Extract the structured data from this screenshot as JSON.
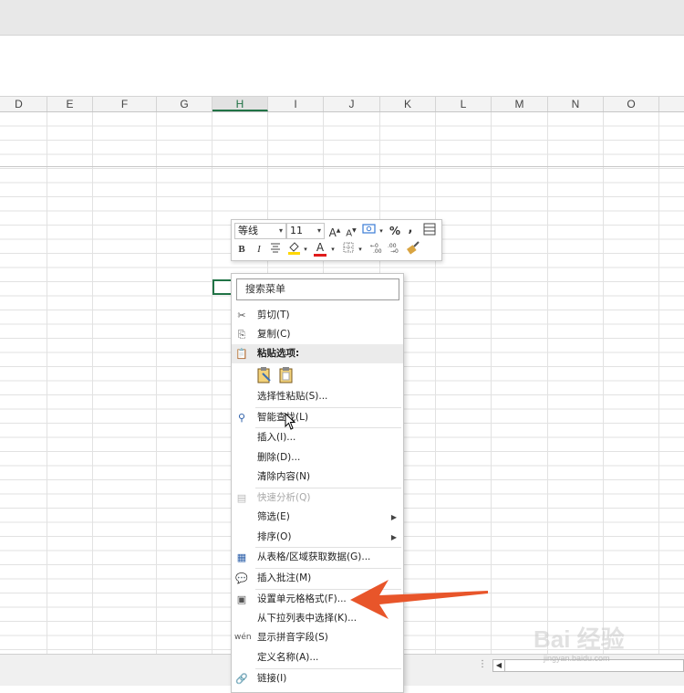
{
  "columns": [
    "D",
    "E",
    "F",
    "G",
    "H",
    "I",
    "J",
    "K",
    "L",
    "M",
    "N",
    "O"
  ],
  "selected_column": "H",
  "mini_toolbar": {
    "font_name": "等线",
    "font_size": "11",
    "grow_font": "A",
    "shrink_font": "A",
    "percent": "%",
    "comma": ",",
    "bold": "B",
    "italic": "I",
    "font_color_letter": "A"
  },
  "context_menu": {
    "search_placeholder": "搜索菜单",
    "items": {
      "cut": "剪切(T)",
      "copy": "复制(C)",
      "paste_options": "粘贴选项:",
      "paste_special": "选择性粘贴(S)...",
      "smart_lookup": "智能查找(L)",
      "insert": "插入(I)...",
      "delete": "删除(D)...",
      "clear_contents": "清除内容(N)",
      "quick_analysis": "快速分析(Q)",
      "filter": "筛选(E)",
      "sort": "排序(O)",
      "get_data_from_table": "从表格/区域获取数据(G)...",
      "insert_comment": "插入批注(M)",
      "format_cells": "设置单元格格式(F)...",
      "pick_from_list": "从下拉列表中选择(K)...",
      "show_phonetic": "显示拼音字段(S)",
      "define_name": "定义名称(A)...",
      "link": "链接(I)"
    }
  },
  "watermark": {
    "brand": "Bai 经验",
    "url": "jingyan.baidu.com"
  },
  "colors": {
    "accent_green": "#217346",
    "arrow_orange": "#e8552a",
    "fill_yellow": "#ffd700",
    "font_red": "#e01b1b"
  }
}
